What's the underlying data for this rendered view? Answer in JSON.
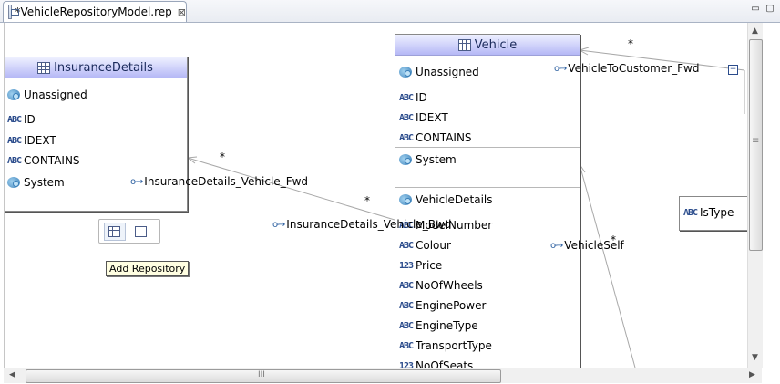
{
  "tab": {
    "title": "*VehicleRepositoryModel.rep",
    "close": "⊠"
  },
  "window_buttons": {
    "minimize": "▭",
    "maximize": "▢"
  },
  "insurance": {
    "title": "InsuranceDetails",
    "group1": "Unassigned",
    "attrs": [
      "ID",
      "IDEXT",
      "CONTAINS"
    ],
    "group2": "System"
  },
  "vehicle": {
    "title": "Vehicle",
    "group1": "Unassigned",
    "attrs1": [
      "ID",
      "IDEXT",
      "CONTAINS"
    ],
    "group2": "System",
    "group3": "VehicleDetails",
    "attrs2": [
      "ModelNumber",
      "Colour"
    ],
    "num_attr": "Price",
    "attrs3": [
      "NoOfWheels",
      "EnginePower",
      "EngineType",
      "TransportType"
    ],
    "num_attr2": "NoOfSeats"
  },
  "istype": {
    "label": "IsType"
  },
  "relations": {
    "vehicle_to_customer": "VehicleToCustomer_Fwd",
    "insurance_vehicle_fwd": "InsuranceDetails_Vehicle_Fwd",
    "insurance_vehicle_bwd": "InsuranceDetails_Vehicle_Bwd",
    "vehicle_self": "VehicleSelf",
    "multiplicity": "*"
  },
  "palette": {
    "tooltip": "Add Repository"
  },
  "icons": {
    "abc": "ABC",
    "num": "123"
  },
  "scrollbar": {
    "grip_h": "III",
    "grip_v": "≡"
  }
}
